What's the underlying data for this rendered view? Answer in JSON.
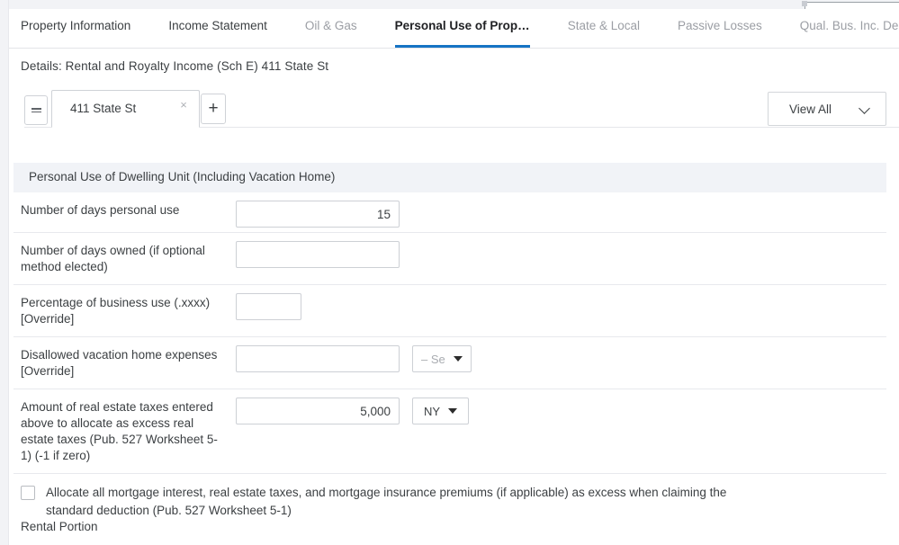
{
  "window": {
    "top_partial_control": "",
    "left_gutter": true
  },
  "tabbar": {
    "tabs": [
      {
        "label": "Property Information",
        "active": false,
        "tone": "dark"
      },
      {
        "label": "Income Statement",
        "active": false,
        "tone": "dark"
      },
      {
        "label": "Oil & Gas",
        "active": false,
        "tone": "light"
      },
      {
        "label": "Personal Use of Prop…",
        "active": true,
        "tone": "dark"
      },
      {
        "label": "State & Local",
        "active": false,
        "tone": "light"
      },
      {
        "label": "Passive Losses",
        "active": false,
        "tone": "light"
      },
      {
        "label": "Qual. Bus. Inc. Dedu…",
        "active": false,
        "tone": "light"
      }
    ],
    "active_accent": "#1674c4"
  },
  "details": {
    "title": "Details: Rental and Royalty Income (Sch E) 411 State St"
  },
  "entity_toolbar": {
    "list_button_icon": "hamburger-icon",
    "entity_tab_label": "411 State St",
    "entity_tab_close_icon": "×",
    "add_button_label": "+",
    "view_all": {
      "label": "View All",
      "caret_icon": "chevron-down-icon"
    }
  },
  "section": {
    "title": "Personal Use of Dwelling Unit (Including Vacation Home)"
  },
  "rows": [
    {
      "label": "Number of days personal use",
      "input_value": "15",
      "input_placeholder": "",
      "input_width": "wide",
      "has_select": false
    },
    {
      "label": "Number of days owned (if optional method elected)",
      "input_value": "",
      "input_placeholder": "",
      "input_width": "wide",
      "has_select": false
    },
    {
      "label": "Percentage of business use (.xxxx) [Override]",
      "input_value": "",
      "input_placeholder": "",
      "input_width": "narrow",
      "has_select": false
    },
    {
      "label": "Disallowed vacation home expenses [Override]",
      "input_value": "",
      "input_placeholder": "",
      "input_width": "wide",
      "has_select": true,
      "select_value": "– Se",
      "select_is_placeholder": true
    },
    {
      "label": "Amount of real estate taxes entered above to allocate as excess real estate taxes (Pub. 527 Worksheet 5-1) (-1 if zero)",
      "input_value": "5,000",
      "input_placeholder": "",
      "input_width": "wide",
      "has_select": true,
      "select_value": "NY",
      "select_is_placeholder": false
    }
  ],
  "checkbox_row": {
    "checked": false,
    "label": "Allocate all mortgage interest, real estate taxes, and mortgage insurance premiums (if applicable) as excess when claiming the standard deduction (Pub. 527 Worksheet 5-1)"
  },
  "footer": {
    "section_title": "Rental Portion"
  }
}
